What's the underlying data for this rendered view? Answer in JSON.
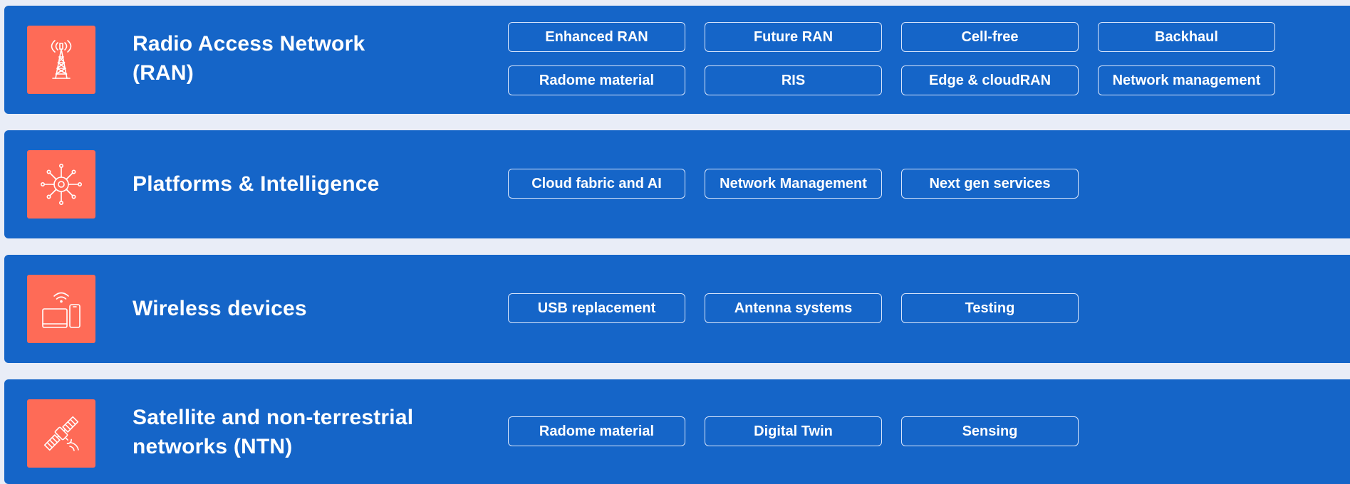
{
  "colors": {
    "band": "#1565c8",
    "icon_tile": "#fe6b57",
    "page_background": "#e9edf7",
    "chip_border": "#d8e5fb",
    "text": "#ffffff"
  },
  "categories": [
    {
      "icon": "radio-tower-icon",
      "title_lines": [
        "Radio Access Network",
        "(RAN)"
      ],
      "chips": [
        "Enhanced RAN",
        "Future RAN",
        "Cell-free",
        "Backhaul",
        "Radome material",
        "RIS",
        "Edge & cloudRAN",
        "Network management"
      ]
    },
    {
      "icon": "network-hub-gear-icon",
      "title_lines": [
        "Platforms & Intelligence"
      ],
      "chips": [
        "Cloud fabric and AI",
        "Network Management",
        "Next gen services"
      ]
    },
    {
      "icon": "wireless-devices-icon",
      "title_lines": [
        "Wireless devices"
      ],
      "chips": [
        "USB replacement",
        "Antenna systems",
        "Testing"
      ]
    },
    {
      "icon": "satellite-icon",
      "title_lines": [
        "Satellite and non-terrestrial",
        "networks (NTN)"
      ],
      "chips": [
        "Radome material",
        "Digital Twin",
        "Sensing"
      ]
    }
  ]
}
